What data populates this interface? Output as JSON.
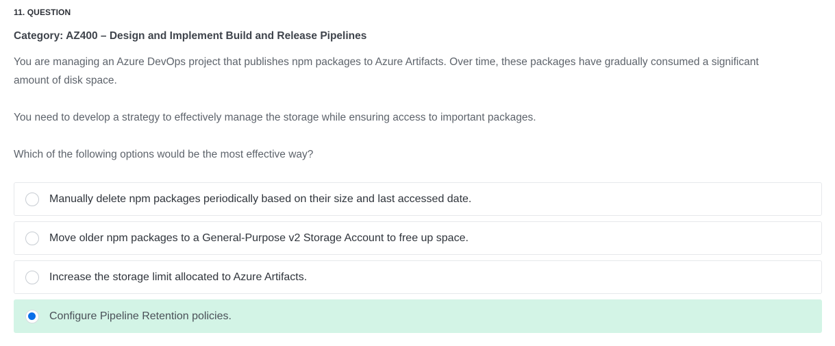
{
  "question": {
    "number_label": "11. QUESTION",
    "category": "Category: AZ400 – Design and Implement Build and Release Pipelines",
    "paragraph_1": "You are managing an Azure DevOps project that publishes npm packages to Azure Artifacts. Over time, these packages have gradually consumed a significant amount of disk space.",
    "paragraph_2": "You need to develop a strategy to effectively manage the storage while ensuring access to important packages.",
    "paragraph_3": "Which of the following options would be the most effective way?"
  },
  "options": [
    {
      "label": "Manually delete npm packages periodically based on their size and last accessed date.",
      "selected": false
    },
    {
      "label": "Move older npm packages to a General-Purpose v2 Storage Account to free up space.",
      "selected": false
    },
    {
      "label": "Increase the storage limit allocated to Azure Artifacts.",
      "selected": false
    },
    {
      "label": "Configure Pipeline Retention policies.",
      "selected": true
    }
  ],
  "colors": {
    "selected_background": "#d3f4e6",
    "radio_checked": "#0a6ee8",
    "border": "#e6e8eb"
  }
}
